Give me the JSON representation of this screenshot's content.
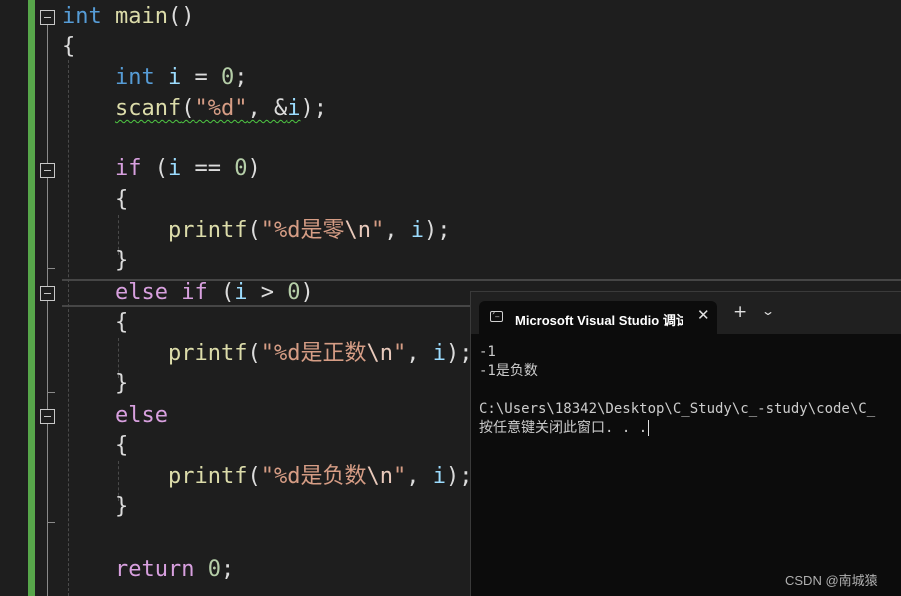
{
  "editor": {
    "lines": {
      "l1": {
        "kw": "int",
        "fn": "main",
        "rest": "()"
      },
      "l2": "{",
      "l3": {
        "kw": "int",
        "var": "i",
        "op": " = ",
        "num": "0",
        "end": ";"
      },
      "l4": {
        "fn": "scanf",
        "open": "(",
        "str": "\"%d\"",
        "mid": ", &",
        "var": "i",
        "end": ");"
      },
      "l5": {
        "kw": "if",
        "open": " (",
        "var": "i",
        "op": " == ",
        "num": "0",
        "end": ")"
      },
      "l6": "{",
      "l7": {
        "fn": "printf",
        "open": "(",
        "str1": "\"%d是零",
        "esc": "\\n",
        "str2": "\"",
        "mid": ", ",
        "var": "i",
        "end": ");"
      },
      "l8": "}",
      "l9": {
        "kw1": "else",
        "kw2": "if",
        "open": " (",
        "var": "i",
        "op": " > ",
        "num": "0",
        "end": ")"
      },
      "l10": "{",
      "l11": {
        "fn": "printf",
        "open": "(",
        "str1": "\"%d是正数",
        "esc": "\\n",
        "str2": "\"",
        "mid": ", ",
        "var": "i",
        "end": ");"
      },
      "l12": "}",
      "l13": {
        "kw": "else"
      },
      "l14": "{",
      "l15": {
        "fn": "printf",
        "open": "(",
        "str1": "\"%d是负数",
        "esc": "\\n",
        "str2": "\"",
        "mid": ", ",
        "var": "i",
        "end": ");"
      },
      "l16": "}",
      "l17": {
        "kw": "return",
        "num": "0",
        "end": ";"
      }
    }
  },
  "console": {
    "tab_title": "Microsoft Visual Studio 调试控制台",
    "output": [
      "-1",
      "-1是负数",
      "",
      "C:\\Users\\18342\\Desktop\\C_Study\\c_-study\\code\\C_",
      "按任意键关闭此窗口. . ."
    ]
  },
  "watermark": "CSDN @南城猿",
  "colors": {
    "change_bar": "#57a64a",
    "keyword": "#569cd6",
    "control": "#d8a0df",
    "function": "#dcdcaa",
    "string": "#d69d85",
    "number": "#b5cea8"
  }
}
